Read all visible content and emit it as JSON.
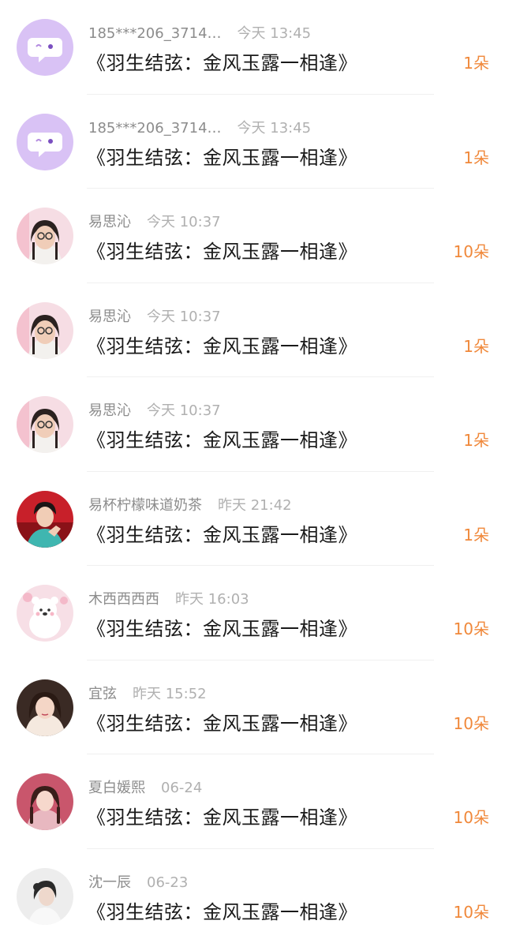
{
  "items": [
    {
      "name": "185***206_3714…",
      "time": "今天 13:45",
      "title": "《羽生结弦：金风玉露一相逢》",
      "count": "1朵",
      "avatar": "chat-bubble-icon"
    },
    {
      "name": "185***206_3714…",
      "time": "今天 13:45",
      "title": "《羽生结弦：金风玉露一相逢》",
      "count": "1朵",
      "avatar": "chat-bubble-icon"
    },
    {
      "name": "易思沁",
      "time": "今天 10:37",
      "title": "《羽生结弦：金风玉露一相逢》",
      "count": "10朵",
      "avatar": "user-avatar"
    },
    {
      "name": "易思沁",
      "time": "今天 10:37",
      "title": "《羽生结弦：金风玉露一相逢》",
      "count": "1朵",
      "avatar": "user-avatar"
    },
    {
      "name": "易思沁",
      "time": "今天 10:37",
      "title": "《羽生结弦：金风玉露一相逢》",
      "count": "1朵",
      "avatar": "user-avatar"
    },
    {
      "name": "易杯柠檬味道奶茶",
      "time": "昨天 21:42",
      "title": "《羽生结弦：金风玉露一相逢》",
      "count": "1朵",
      "avatar": "user-avatar"
    },
    {
      "name": "木西西西西",
      "time": "昨天 16:03",
      "title": "《羽生结弦：金风玉露一相逢》",
      "count": "10朵",
      "avatar": "user-avatar"
    },
    {
      "name": "宜弦",
      "time": "昨天 15:52",
      "title": "《羽生结弦：金风玉露一相逢》",
      "count": "10朵",
      "avatar": "user-avatar"
    },
    {
      "name": "夏白媛熙",
      "time": "06-24",
      "title": "《羽生结弦：金风玉露一相逢》",
      "count": "10朵",
      "avatar": "user-avatar"
    },
    {
      "name": "沈一辰",
      "time": "06-23",
      "title": "《羽生结弦：金风玉露一相逢》",
      "count": "10朵",
      "avatar": "user-avatar"
    }
  ],
  "colors": {
    "accent": "#f0883a",
    "default_avatar": "#d9c2f5"
  }
}
